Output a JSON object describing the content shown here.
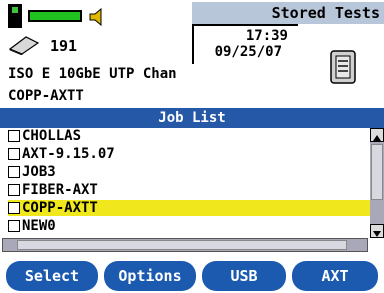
{
  "header": {
    "title": "Stored Tests",
    "count": "191",
    "time": "17:39",
    "date": "09/25/07",
    "job_line1": "ISO E 10GbE UTP Chan",
    "job_line2": "COPP-AXTT"
  },
  "list": {
    "title": "Job List",
    "items": [
      {
        "label": "CHOLLAS"
      },
      {
        "label": "AXT-9.15.07"
      },
      {
        "label": "JOB3"
      },
      {
        "label": "FIBER-AXT"
      },
      {
        "label": "COPP-AXTT"
      },
      {
        "label": "NEW0"
      }
    ],
    "selected_item": "COPP-AXTT"
  },
  "footer": {
    "buttons": [
      {
        "label": "Select"
      },
      {
        "label": "Options"
      },
      {
        "label": "USB"
      },
      {
        "label": "AXT"
      }
    ]
  },
  "colors": {
    "title_bar": "#b8c6da",
    "list_header": "#2658a8",
    "selection": "#f0e81c",
    "footer_button": "#1c5ab0",
    "indicator": "#20c020"
  }
}
